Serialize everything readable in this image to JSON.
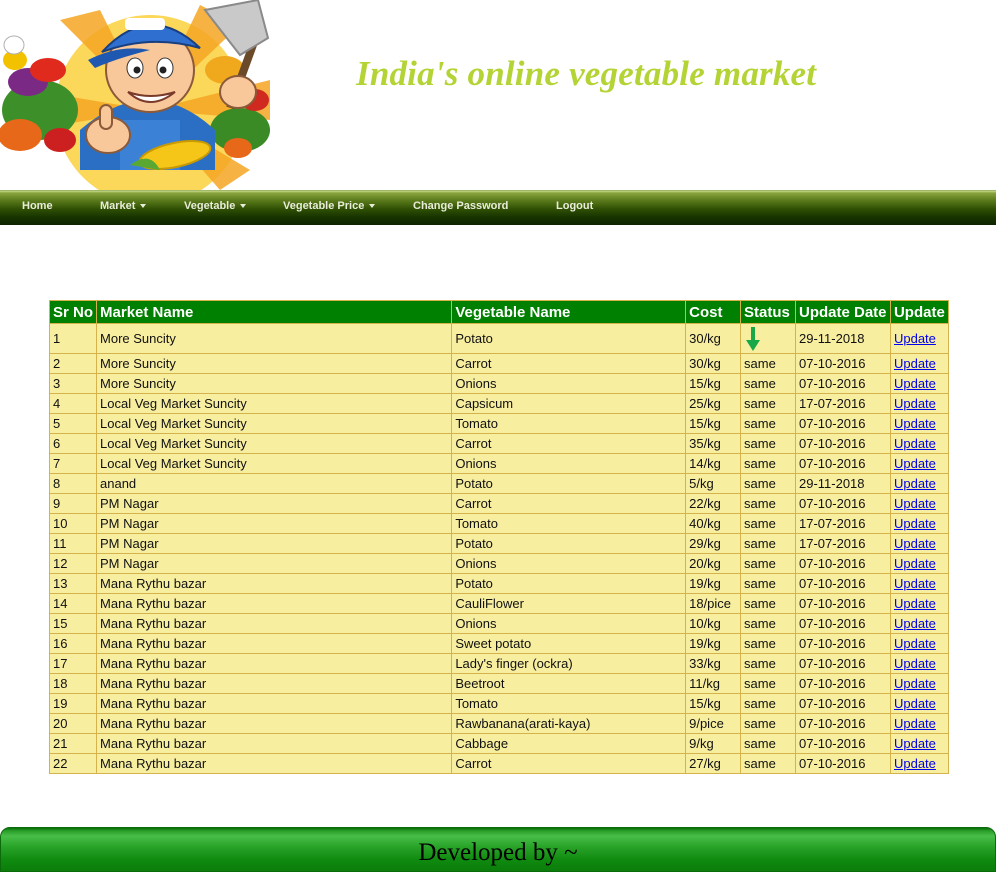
{
  "header": {
    "title": "India's online vegetable market"
  },
  "nav": {
    "items": [
      {
        "label": "Home",
        "dropdown": false
      },
      {
        "label": "Market",
        "dropdown": true
      },
      {
        "label": "Vegetable",
        "dropdown": true
      },
      {
        "label": "Vegetable Price",
        "dropdown": true
      },
      {
        "label": "Change Password",
        "dropdown": false
      },
      {
        "label": "Logout",
        "dropdown": false
      }
    ]
  },
  "table": {
    "headers": [
      "Sr No",
      "Market Name",
      "Vegetable Name",
      "Cost",
      "Status",
      "Update Date",
      "Update"
    ],
    "rows": [
      {
        "sr": "1",
        "market": "More Suncity",
        "vegetable": "Potato",
        "cost": "30/kg",
        "status": "down-arrow",
        "date": "29-11-2018",
        "action": "Update"
      },
      {
        "sr": "2",
        "market": "More Suncity",
        "vegetable": "Carrot",
        "cost": "30/kg",
        "status": "same",
        "date": "07-10-2016",
        "action": "Update"
      },
      {
        "sr": "3",
        "market": "More Suncity",
        "vegetable": "Onions",
        "cost": "15/kg",
        "status": "same",
        "date": "07-10-2016",
        "action": "Update"
      },
      {
        "sr": "4",
        "market": "Local Veg Market Suncity",
        "vegetable": "Capsicum",
        "cost": "25/kg",
        "status": "same",
        "date": "17-07-2016",
        "action": "Update"
      },
      {
        "sr": "5",
        "market": "Local Veg Market Suncity",
        "vegetable": "Tomato",
        "cost": "15/kg",
        "status": "same",
        "date": "07-10-2016",
        "action": "Update"
      },
      {
        "sr": "6",
        "market": "Local Veg Market Suncity",
        "vegetable": "Carrot",
        "cost": "35/kg",
        "status": "same",
        "date": "07-10-2016",
        "action": "Update"
      },
      {
        "sr": "7",
        "market": "Local Veg Market Suncity",
        "vegetable": "Onions",
        "cost": "14/kg",
        "status": "same",
        "date": "07-10-2016",
        "action": "Update"
      },
      {
        "sr": "8",
        "market": "anand",
        "vegetable": "Potato",
        "cost": "5/kg",
        "status": "same",
        "date": "29-11-2018",
        "action": "Update"
      },
      {
        "sr": "9",
        "market": "PM Nagar",
        "vegetable": "Carrot",
        "cost": "22/kg",
        "status": "same",
        "date": "07-10-2016",
        "action": "Update"
      },
      {
        "sr": "10",
        "market": "PM Nagar",
        "vegetable": "Tomato",
        "cost": "40/kg",
        "status": "same",
        "date": "17-07-2016",
        "action": "Update"
      },
      {
        "sr": "11",
        "market": "PM Nagar",
        "vegetable": "Potato",
        "cost": "29/kg",
        "status": "same",
        "date": "17-07-2016",
        "action": "Update"
      },
      {
        "sr": "12",
        "market": "PM Nagar",
        "vegetable": "Onions",
        "cost": "20/kg",
        "status": "same",
        "date": "07-10-2016",
        "action": "Update"
      },
      {
        "sr": "13",
        "market": "Mana Rythu bazar",
        "vegetable": "Potato",
        "cost": "19/kg",
        "status": "same",
        "date": "07-10-2016",
        "action": "Update"
      },
      {
        "sr": "14",
        "market": "Mana Rythu bazar",
        "vegetable": "CauliFlower",
        "cost": "18/pice",
        "status": "same",
        "date": "07-10-2016",
        "action": "Update"
      },
      {
        "sr": "15",
        "market": "Mana Rythu bazar",
        "vegetable": "Onions",
        "cost": "10/kg",
        "status": "same",
        "date": "07-10-2016",
        "action": "Update"
      },
      {
        "sr": "16",
        "market": "Mana Rythu bazar",
        "vegetable": "Sweet potato",
        "cost": "19/kg",
        "status": "same",
        "date": "07-10-2016",
        "action": "Update"
      },
      {
        "sr": "17",
        "market": "Mana Rythu bazar",
        "vegetable": "Lady's finger (ockra)",
        "cost": "33/kg",
        "status": "same",
        "date": "07-10-2016",
        "action": "Update"
      },
      {
        "sr": "18",
        "market": "Mana Rythu bazar",
        "vegetable": "Beetroot",
        "cost": "11/kg",
        "status": "same",
        "date": "07-10-2016",
        "action": "Update"
      },
      {
        "sr": "19",
        "market": "Mana Rythu bazar",
        "vegetable": "Tomato",
        "cost": "15/kg",
        "status": "same",
        "date": "07-10-2016",
        "action": "Update"
      },
      {
        "sr": "20",
        "market": "Mana Rythu bazar",
        "vegetable": "Rawbanana(arati-kaya)",
        "cost": "9/pice",
        "status": "same",
        "date": "07-10-2016",
        "action": "Update"
      },
      {
        "sr": "21",
        "market": "Mana Rythu bazar",
        "vegetable": "Cabbage",
        "cost": "9/kg",
        "status": "same",
        "date": "07-10-2016",
        "action": "Update"
      },
      {
        "sr": "22",
        "market": "Mana Rythu bazar",
        "vegetable": "Carrot",
        "cost": "27/kg",
        "status": "same",
        "date": "07-10-2016",
        "action": "Update"
      }
    ]
  },
  "footer": {
    "text": "Developed by ~"
  },
  "colors": {
    "title": "#b4d334",
    "table_header": "#008000",
    "table_cell": "#f8ee9f",
    "table_border": "#d4b24c",
    "status_down_arrow": "#18a848",
    "footer": "#1f9a1f"
  }
}
